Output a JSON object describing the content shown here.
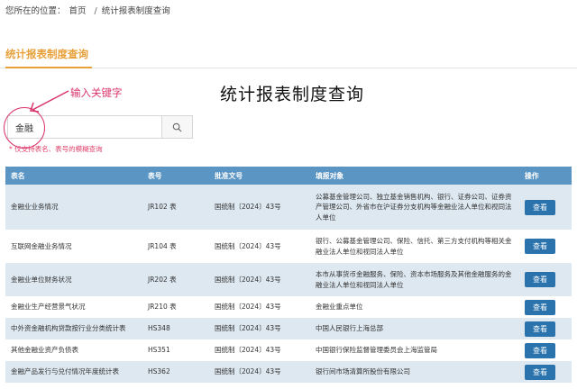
{
  "breadcrumb": {
    "prefix": "您所在的位置：",
    "home": "首页",
    "separator": "/",
    "current": "统计报表制度查询"
  },
  "tab": {
    "label": "统计报表制度查询"
  },
  "page_title": "统计报表制度查询",
  "annotation": {
    "text": "输入关键字",
    "color": "#d9336b"
  },
  "search": {
    "value": "金融",
    "placeholder": "",
    "button_icon": "search-icon"
  },
  "hint": "* 仅支持表名、表号的模糊查询",
  "table": {
    "headers": [
      "表名",
      "表号",
      "批准文号",
      "填报对象",
      "操作"
    ],
    "rows": [
      {
        "name": "金融业业务情况",
        "code": "JR102 表",
        "approval": "国统制〔2024〕43号",
        "target": "公募基金管理公司、独立基金销售机构、银行、证券公司、证券资产管理公司、外省市在沪证券分支机构等金融业法人单位和视同法人单位",
        "action": "查看"
      },
      {
        "name": "互联网金融业务情况",
        "code": "JR104 表",
        "approval": "国统制〔2024〕43号",
        "target": "银行、公募基金管理公司、保险、信托、第三方支付机构等相关金融业法人单位和视同法人单位",
        "action": "查看"
      },
      {
        "name": "金融业单位财务状况",
        "code": "JR202 表",
        "approval": "国统制〔2024〕43号",
        "target": "本市从事货币金融服务、保险、资本市场服务及其他金融服务的金融业法人单位和视同法人单位",
        "action": "查看"
      },
      {
        "name": "金融业生产经营景气状况",
        "code": "JR210 表",
        "approval": "国统制〔2024〕43号",
        "target": "金融业重点单位",
        "action": "查看"
      },
      {
        "name": "中外资金融机构贷款按行业分类统计表",
        "code": "HS348",
        "approval": "国统制〔2024〕43号",
        "target": "中国人民银行上海总部",
        "action": "查看"
      },
      {
        "name": "其他金融业资产负债表",
        "code": "HS351",
        "approval": "国统制〔2024〕43号",
        "target": "中国银行保险监督管理委员会上海监管局",
        "action": "查看"
      },
      {
        "name": "金融产品发行与兑付情况年度统计表",
        "code": "HS362",
        "approval": "国统制〔2024〕43号",
        "target": "银行间市场清算所股份有限公司",
        "action": "查看"
      }
    ]
  },
  "colors": {
    "accent": "#e8a13a",
    "header_bg": "#5b95c4",
    "row_alt": "#dde8f1",
    "button": "#2b73ad",
    "hint": "#e0406a"
  }
}
